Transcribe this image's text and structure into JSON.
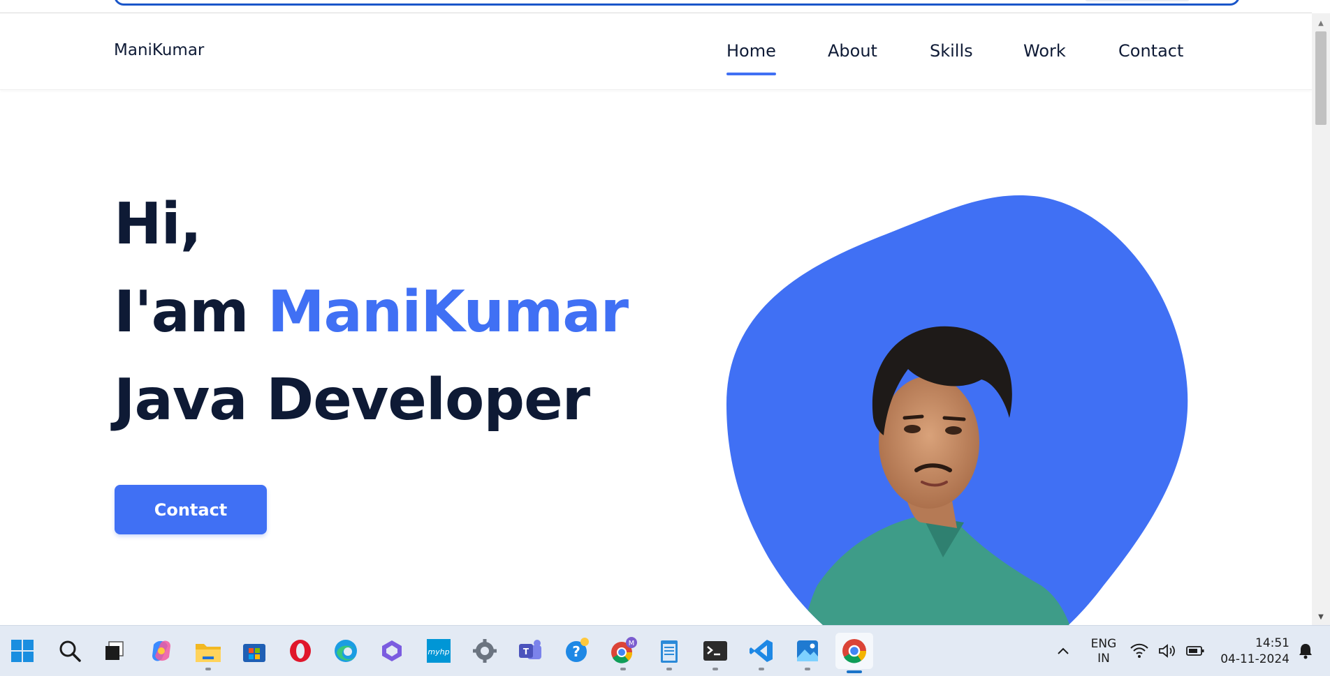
{
  "nav": {
    "logo": "ManiKumar",
    "links": [
      {
        "label": "Home",
        "active": true
      },
      {
        "label": "About",
        "active": false
      },
      {
        "label": "Skills",
        "active": false
      },
      {
        "label": "Work",
        "active": false
      },
      {
        "label": "Contact",
        "active": false
      }
    ]
  },
  "hero": {
    "line1": "Hi,",
    "line2_prefix": "I'am ",
    "line2_name": "ManiKumar",
    "line3": "Java Developer",
    "cta_label": "Contact"
  },
  "colors": {
    "accent": "#4070f4",
    "heading": "#0e1a35"
  },
  "taskbar": {
    "icons": [
      "windows-start-icon",
      "search-icon",
      "task-view-icon",
      "copilot-icon",
      "file-explorer-icon",
      "microsoft-store-icon",
      "opera-icon",
      "edge-icon",
      "m365-icon",
      "myhp-icon",
      "settings-icon",
      "teams-icon",
      "get-help-icon",
      "chrome-profile-icon",
      "notepad-icon",
      "terminal-icon",
      "vscode-icon",
      "photos-icon",
      "chrome-icon"
    ],
    "myhp_label": "myhp",
    "profile_badge": "M",
    "lang_top": "ENG",
    "lang_bottom": "IN",
    "time": "14:51",
    "date": "04-11-2024"
  }
}
